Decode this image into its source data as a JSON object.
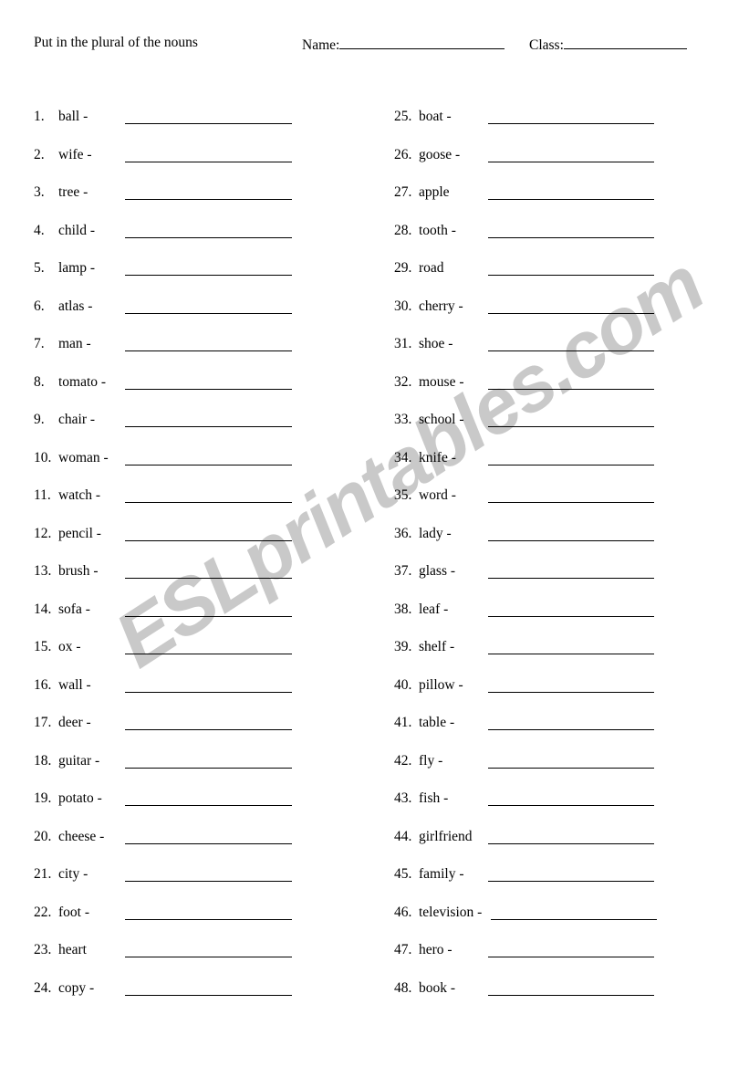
{
  "worksheet": {
    "title": "Put in the plural of the nouns",
    "fields": [
      {
        "label": "Name:",
        "value": ""
      },
      {
        "label": "Class:",
        "value": ""
      }
    ],
    "watermark": "ESLprintables.com",
    "watermark_color": "#c9c9c9"
  },
  "columns": {
    "left": [
      {
        "num": "1.",
        "word": "ball -"
      },
      {
        "num": "2.",
        "word": "wife -"
      },
      {
        "num": "3.",
        "word": "tree -"
      },
      {
        "num": "4.",
        "word": "child -"
      },
      {
        "num": "5.",
        "word": "lamp -"
      },
      {
        "num": "6.",
        "word": "atlas -"
      },
      {
        "num": "7.",
        "word": "man -"
      },
      {
        "num": "8.",
        "word": "tomato -"
      },
      {
        "num": "9.",
        "word": "chair -"
      },
      {
        "num": "10.",
        "word": "woman -"
      },
      {
        "num": "11.",
        "word": "watch -"
      },
      {
        "num": "12.",
        "word": "pencil -"
      },
      {
        "num": "13.",
        "word": "brush -"
      },
      {
        "num": "14.",
        "word": "sofa -"
      },
      {
        "num": "15.",
        "word": "ox -"
      },
      {
        "num": "16.",
        "word": "wall -"
      },
      {
        "num": "17.",
        "word": "deer -"
      },
      {
        "num": "18.",
        "word": "guitar -"
      },
      {
        "num": "19.",
        "word": "potato -"
      },
      {
        "num": "20.",
        "word": "cheese -"
      },
      {
        "num": "21.",
        "word": "city -"
      },
      {
        "num": "22.",
        "word": "foot -"
      },
      {
        "num": "23.",
        "word": "heart"
      },
      {
        "num": "24.",
        "word": "copy -"
      }
    ],
    "right": [
      {
        "num": "25.",
        "word": "boat -"
      },
      {
        "num": "26.",
        "word": "goose -"
      },
      {
        "num": "27.",
        "word": "apple"
      },
      {
        "num": "28.",
        "word": "tooth -"
      },
      {
        "num": "29.",
        "word": "road"
      },
      {
        "num": "30.",
        "word": "cherry -"
      },
      {
        "num": "31.",
        "word": "shoe -"
      },
      {
        "num": "32.",
        "word": "mouse -"
      },
      {
        "num": "33.",
        "word": "school -"
      },
      {
        "num": "34.",
        "word": "knife -"
      },
      {
        "num": "35.",
        "word": "word -"
      },
      {
        "num": "36.",
        "word": "lady -"
      },
      {
        "num": "37.",
        "word": "glass -"
      },
      {
        "num": "38.",
        "word": "leaf -"
      },
      {
        "num": "39.",
        "word": "shelf -"
      },
      {
        "num": "40.",
        "word": "pillow -"
      },
      {
        "num": "41.",
        "word": "table -"
      },
      {
        "num": "42.",
        "word": "fly -"
      },
      {
        "num": "43.",
        "word": "fish -"
      },
      {
        "num": "44.",
        "word": "girlfriend"
      },
      {
        "num": "45.",
        "word": "family -"
      },
      {
        "num": "46.",
        "word": "television -"
      },
      {
        "num": "47.",
        "word": "hero -"
      },
      {
        "num": "48.",
        "word": "book -"
      }
    ]
  }
}
